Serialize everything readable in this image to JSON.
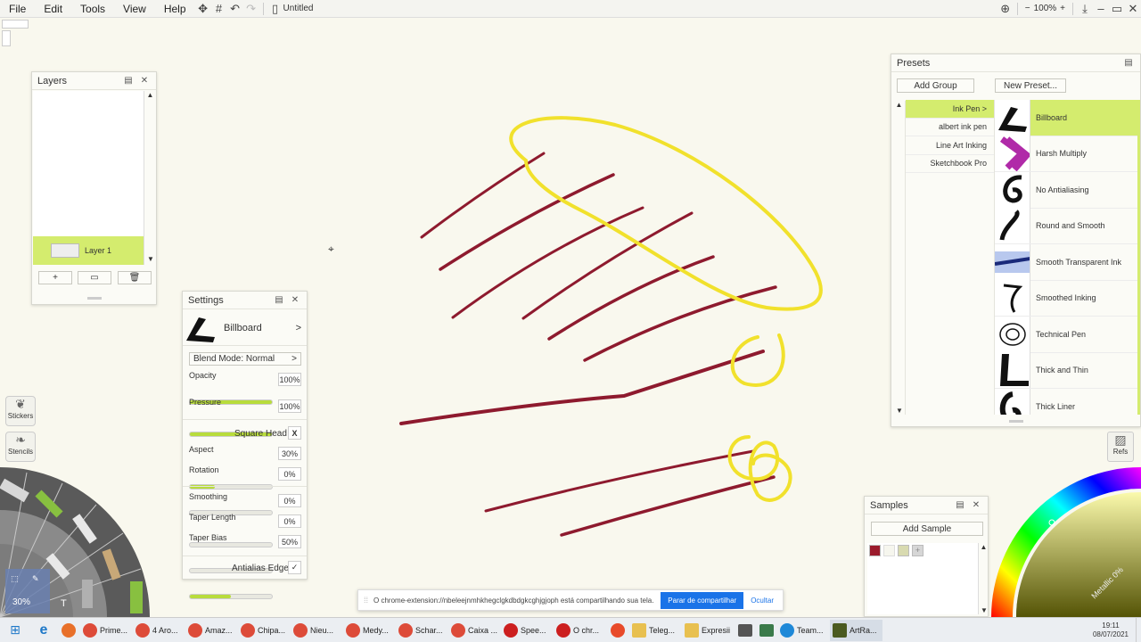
{
  "menu": {
    "file": "File",
    "edit": "Edit",
    "tools": "Tools",
    "view": "View",
    "help": "Help",
    "doc_title": "Untitled",
    "zoom": "100%"
  },
  "layers": {
    "title": "Layers",
    "items": [
      {
        "label": "Layer 1"
      }
    ]
  },
  "settings": {
    "title": "Settings",
    "preset_name": "Billboard",
    "blend_mode": "Blend Mode: Normal",
    "opacity_label": "Opacity",
    "opacity_value": "100%",
    "opacity": 1.0,
    "pressure_label": "Pressure",
    "pressure_value": "100%",
    "pressure": 1.0,
    "square_head_label": "Square Head",
    "square_head_mark": "X",
    "aspect_label": "Aspect",
    "aspect_value": "30%",
    "aspect": 0.3,
    "rotation_label": "Rotation",
    "rotation_value": "0%",
    "rotation": 0.0,
    "smoothing_label": "Smoothing",
    "smoothing_value": "0%",
    "smoothing": 0.0,
    "taper_length_label": "Taper Length",
    "taper_length_value": "0%",
    "taper_length": 0.0,
    "taper_bias_label": "Taper Bias",
    "taper_bias_value": "50%",
    "taper_bias": 0.5,
    "antialias_label": "Antialias Edge",
    "antialias_mark": "✓"
  },
  "presets": {
    "title": "Presets",
    "add_group": "Add Group",
    "new_preset": "New Preset...",
    "groups": [
      "Ink Pen  >",
      "albert ink pen",
      "Line Art Inking",
      "Sketchbook Pro"
    ],
    "items": [
      "Billboard",
      "Harsh Multiply",
      "No Antialiasing",
      "Round and Smooth",
      "Smooth Transparent Ink",
      "Smoothed Inking",
      "Technical Pen",
      "Thick and Thin",
      "Thick Liner"
    ]
  },
  "samples": {
    "title": "Samples",
    "add_sample": "Add Sample",
    "swatches": [
      "#9b1b2c",
      "#f6f6ee",
      "#d8dab0",
      "#d6d6d6"
    ]
  },
  "tools": {
    "stickers": "Stickers",
    "stencils": "Stencils",
    "size": "30%",
    "refs": "Refs",
    "metallic": "Metallic 0%"
  },
  "notice": {
    "text": "O chrome-extension://nbeleejnmhkhegclgkdbdgkcghjgjoph está compartilhando sua tela.",
    "stop": "Parar de compartilhar",
    "hide": "Ocultar"
  },
  "taskbar": {
    "items": [
      "Prime...",
      "4 Aro...",
      "Amaz...",
      "Chipa...",
      "Nieu...",
      "Medy...",
      "Schar...",
      "Caixa ...",
      "Spee...",
      "O chr...",
      "",
      "Teleg...",
      "Expresii",
      "",
      "",
      "Team...",
      "ArtRa..."
    ],
    "time": "19:11",
    "date": "08/07/2021"
  },
  "colors": {
    "ink": "#8e1a2e",
    "highlight": "#f1e12c",
    "accent": "#d4ec6e",
    "button_blue": "#1a73e8"
  }
}
